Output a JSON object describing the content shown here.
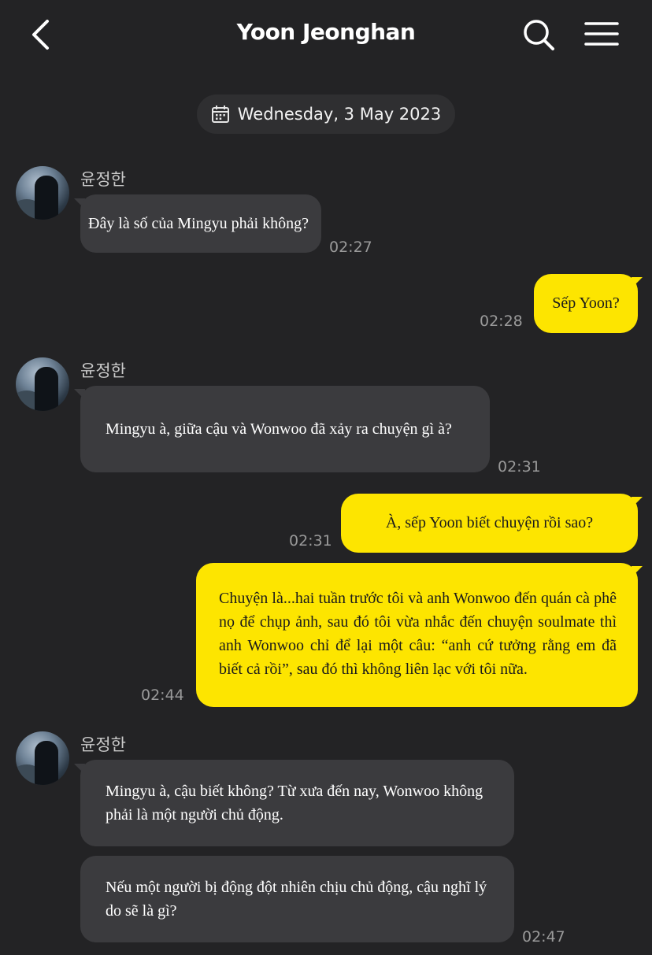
{
  "header": {
    "title": "Yoon Jeonghan",
    "back_icon": "chevron-left-icon",
    "search_icon": "search-icon",
    "menu_icon": "hamburger-menu-icon"
  },
  "date_separator": {
    "icon": "calendar-icon",
    "text": "Wednesday, 3 May 2023"
  },
  "colors": {
    "background": "#232325",
    "incoming_bubble": "#3b3b3e",
    "outgoing_bubble": "#fde500"
  },
  "messages": [
    {
      "sender": "윤정한",
      "text": "Đây là số của Mingyu phải không?",
      "time": "02:27"
    },
    {
      "text": "Sếp Yoon?",
      "time": "02:28"
    },
    {
      "sender": "윤정한",
      "text": "Mingyu à, giữa cậu và Wonwoo đã xảy ra chuyện gì à?",
      "time": "02:31"
    },
    {
      "text": "À, sếp Yoon biết chuyện rồi sao?",
      "time": "02:31"
    },
    {
      "text": "Chuyện là...hai tuần trước tôi và anh Wonwoo đến quán cà phê nọ để chụp ảnh, sau đó tôi vừa nhắc đến chuyện soulmate thì anh Wonwoo chỉ để lại một câu: “anh cứ tưởng rằng em đã biết cả rồi”, sau đó thì không liên lạc với tôi nữa.",
      "time": "02:44"
    },
    {
      "sender": "윤정한",
      "text": "Mingyu à, cậu biết không? Từ xưa đến nay, Wonwoo không phải là một người chủ động."
    },
    {
      "text": "Nếu một người bị động đột nhiên chịu chủ động, cậu nghĩ lý do sẽ là gì?",
      "time": "02:47"
    }
  ]
}
